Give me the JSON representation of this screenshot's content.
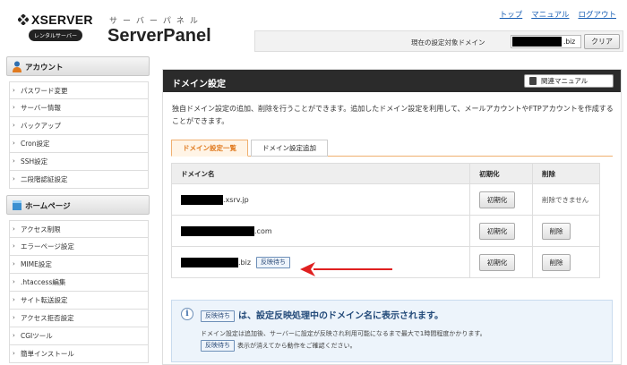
{
  "header": {
    "brand": "XSERVER",
    "brand_sub": "レンタルサーバー",
    "kana": "サーバーパネル",
    "title": "ServerPanel",
    "links": [
      "トップ",
      "マニュアル",
      "ログアウト"
    ],
    "target_label": "現在の設定対象ドメイン",
    "target_tld": ".biz",
    "clear_label": "クリア"
  },
  "sidebar": {
    "account": {
      "title": "アカウント",
      "items": [
        "パスワード変更",
        "サーバー情報",
        "バックアップ",
        "Cron設定",
        "SSH設定",
        "二段階認証設定"
      ]
    },
    "homepage": {
      "title": "ホームページ",
      "items": [
        "アクセス制限",
        "エラーページ設定",
        "MIME設定",
        ".htaccess編集",
        "サイト転送設定",
        "アクセス拒否設定",
        "CGIツール",
        "簡単インストール"
      ]
    }
  },
  "main": {
    "title": "ドメイン設定",
    "manual_label": "関連マニュアル",
    "intro": "独自ドメイン設定の追加、削除を行うことができます。追加したドメイン設定を利用して、メールアカウントやFTPアカウントを作成することができます。",
    "tabs": [
      "ドメイン設定一覧",
      "ドメイン設定追加"
    ],
    "table": {
      "headers": [
        "ドメイン名",
        "初期化",
        "削除"
      ],
      "rows": [
        {
          "suffix": ".xsrv.jp",
          "init": "初期化",
          "delete": "削除できません",
          "pending": ""
        },
        {
          "suffix": ".com",
          "init": "初期化",
          "delete": "削除",
          "pending": ""
        },
        {
          "suffix": ".biz",
          "init": "初期化",
          "delete": "削除",
          "pending": "反映待ち"
        }
      ]
    },
    "note": {
      "badge": "反映待ち",
      "head": "は、設定反映処理中のドメイン名に表示されます。",
      "line1": "ドメイン設定は追加後、サーバーに設定が反映され利用可能になるまで最大で1時間程度かかります。",
      "line2_badge": "反映待ち",
      "line2": "表示が消えてから動作をご確認ください。"
    }
  },
  "colors": {
    "header_bar": "#2b2b2b",
    "tab_active": "#e07a1f",
    "arrow": "#e02020",
    "note_bg": "#edf4fb"
  }
}
